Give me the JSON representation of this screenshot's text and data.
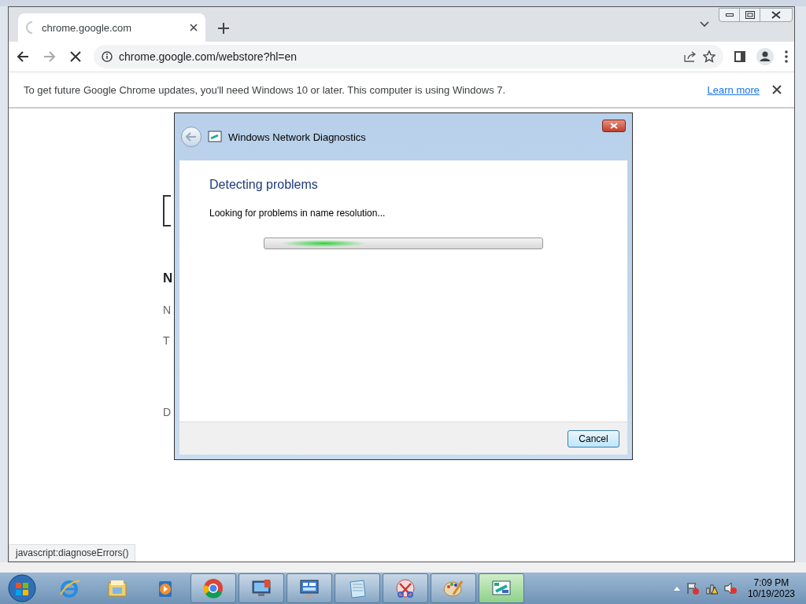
{
  "browser": {
    "tab": {
      "title": "chrome.google.com",
      "loading": true
    },
    "address": "chrome.google.com/webstore?hl=en",
    "infobar": {
      "message": "To get future Google Chrome updates, you'll need Windows 10 or later. This computer is using Windows 7.",
      "link": "Learn more"
    },
    "page_fragments": [
      {
        "kind": "heading",
        "text": "N"
      },
      {
        "kind": "body",
        "text": "N"
      },
      {
        "kind": "body",
        "text": "T"
      },
      {
        "kind": "body",
        "text": "D"
      }
    ],
    "status_url": "javascript:diagnoseErrors()"
  },
  "dialog": {
    "title": "Windows Network Diagnostics",
    "heading": "Detecting problems",
    "message": "Looking for problems in name resolution...",
    "cancel": "Cancel",
    "progress_marquee": true
  },
  "taskbar": {
    "apps": [
      {
        "running": false,
        "selected": false
      },
      {
        "running": false,
        "selected": false
      },
      {
        "running": false,
        "selected": false
      },
      {
        "running": true,
        "selected": false
      },
      {
        "running": true,
        "selected": false
      },
      {
        "running": true,
        "selected": false
      },
      {
        "running": true,
        "selected": false
      },
      {
        "running": true,
        "selected": false
      },
      {
        "running": true,
        "selected": false
      },
      {
        "running": true,
        "selected": true
      }
    ],
    "time": "7:09 PM",
    "date": "10/19/2023"
  }
}
